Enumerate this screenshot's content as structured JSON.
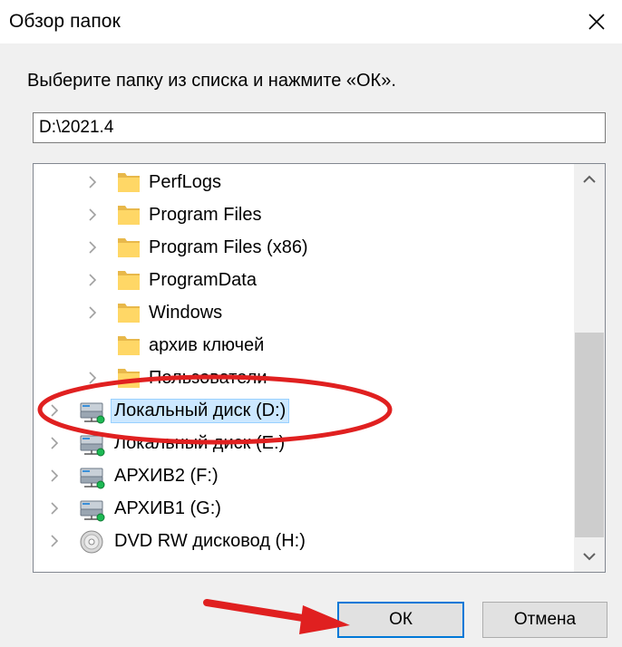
{
  "window": {
    "title": "Обзор папок",
    "close_icon": "close-icon"
  },
  "instruction": "Выберите папку из списка и нажмите «ОК».",
  "path_field": {
    "value": "D:\\2021.4"
  },
  "tree": {
    "items": [
      {
        "label": "PerfLogs",
        "icon": "folder-icon",
        "expandable": true,
        "selected": false
      },
      {
        "label": "Program Files",
        "icon": "folder-icon",
        "expandable": true,
        "selected": false
      },
      {
        "label": "Program Files (x86)",
        "icon": "folder-icon",
        "expandable": true,
        "selected": false
      },
      {
        "label": "ProgramData",
        "icon": "folder-icon",
        "expandable": true,
        "selected": false
      },
      {
        "label": "Windows",
        "icon": "folder-icon",
        "expandable": true,
        "selected": false
      },
      {
        "label": "архив ключей",
        "icon": "folder-icon",
        "expandable": false,
        "selected": false
      },
      {
        "label": "Пользователи",
        "icon": "folder-icon",
        "expandable": true,
        "selected": false
      },
      {
        "label": "Локальный диск (D:)",
        "icon": "network-drive-icon",
        "expandable": true,
        "selected": true
      },
      {
        "label": "Локальный диск (E:)",
        "icon": "network-drive-icon",
        "expandable": true,
        "selected": false
      },
      {
        "label": "АРХИВ2 (F:)",
        "icon": "network-drive-icon",
        "expandable": true,
        "selected": false
      },
      {
        "label": "АРХИВ1 (G:)",
        "icon": "network-drive-icon",
        "expandable": true,
        "selected": false
      },
      {
        "label": "DVD RW дисковод (H:)",
        "icon": "dvd-drive-icon",
        "expandable": true,
        "selected": false
      }
    ]
  },
  "buttons": {
    "ok": "ОК",
    "cancel": "Отмена"
  },
  "colors": {
    "accent": "#0078d7",
    "selection": "#cce8ff",
    "annotation_red": "#e02020",
    "folder": "#ffd766"
  }
}
